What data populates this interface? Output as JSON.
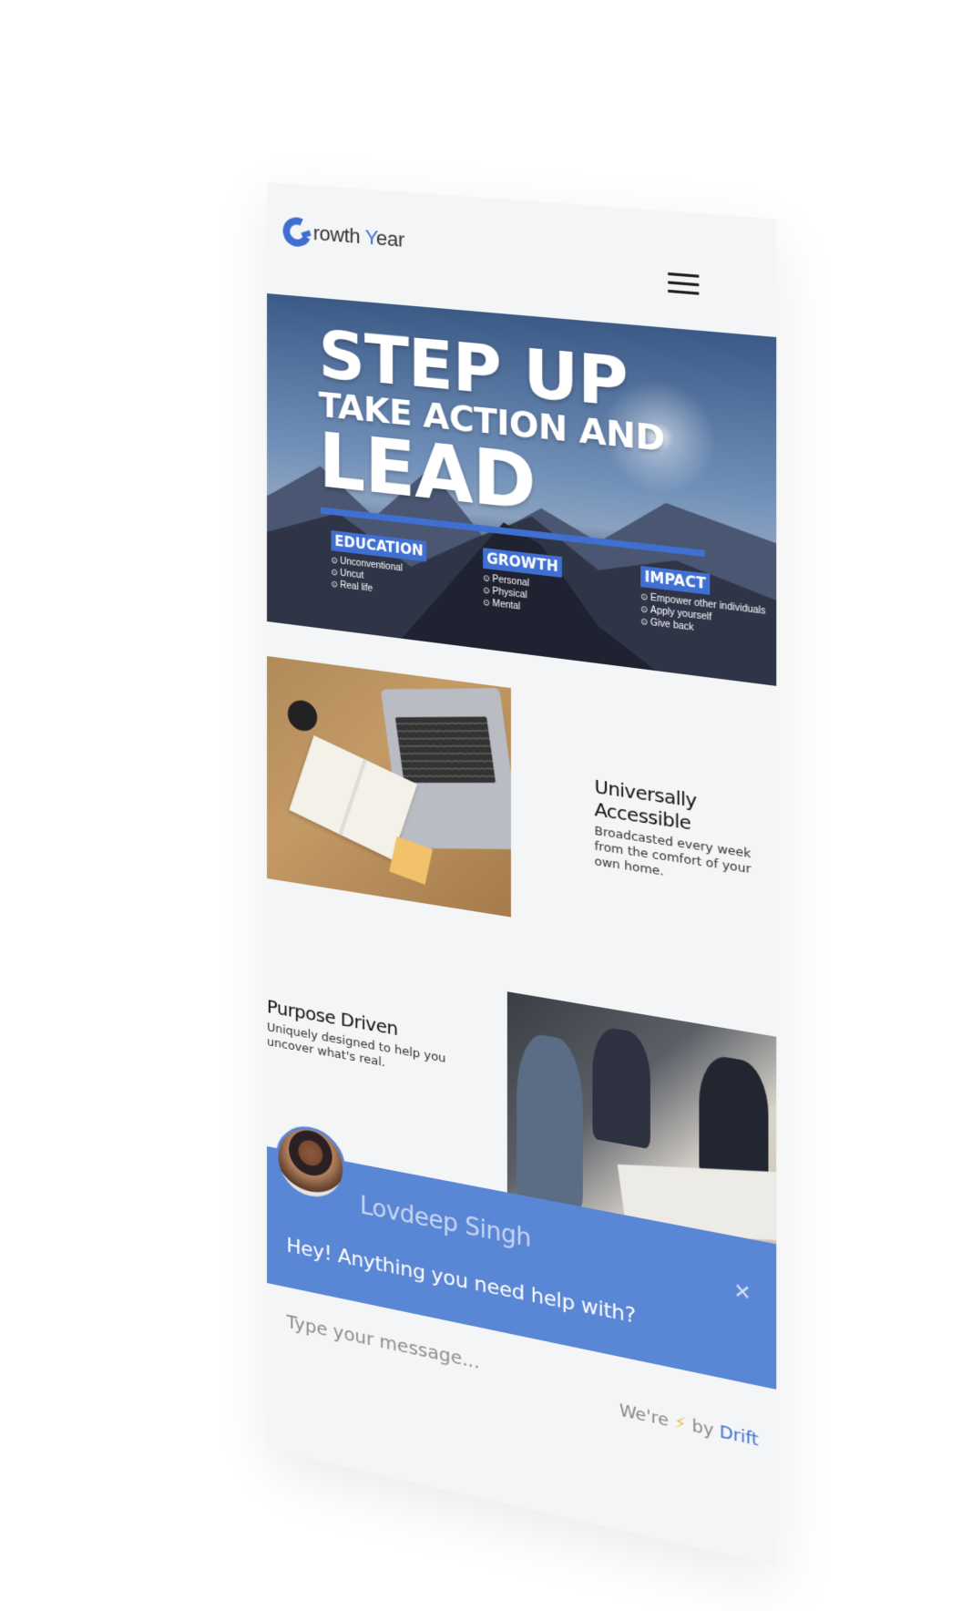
{
  "header": {
    "logo_prefix": "G",
    "logo_text_1": "rowth ",
    "logo_text_2": "Y",
    "logo_text_3": "ear"
  },
  "hero": {
    "line1": "STEP UP",
    "line2": "TAKE ACTION AND",
    "line3": "LEAD",
    "pillars": [
      {
        "title": "EDUCATION",
        "items": [
          "Unconventional",
          "Uncut",
          "Real life"
        ]
      },
      {
        "title": "GROWTH",
        "items": [
          "Personal",
          "Physical",
          "Mental"
        ]
      },
      {
        "title": "IMPACT",
        "items": [
          "Empower other individuals",
          "Apply yourself",
          "Give back"
        ]
      }
    ]
  },
  "features": [
    {
      "title": "Universally Accessible",
      "text": "Broadcasted every week from the comfort of your own home."
    },
    {
      "title": "Purpose Driven",
      "text": "Uniquely designed to help you uncover what's real."
    }
  ],
  "chat": {
    "agent_name": "Lovdeep Singh",
    "message": "Hey! Anything you need help with?",
    "close_symbol": "×",
    "input_placeholder": "Type your message...",
    "footer_prefix": "We're",
    "footer_bolt": "⚡",
    "footer_by": "by",
    "footer_brand": "Drift"
  },
  "colors": {
    "brand_blue": "#3f6fd1",
    "chat_blue": "#5a86d6",
    "background": "#f4f5f7"
  }
}
